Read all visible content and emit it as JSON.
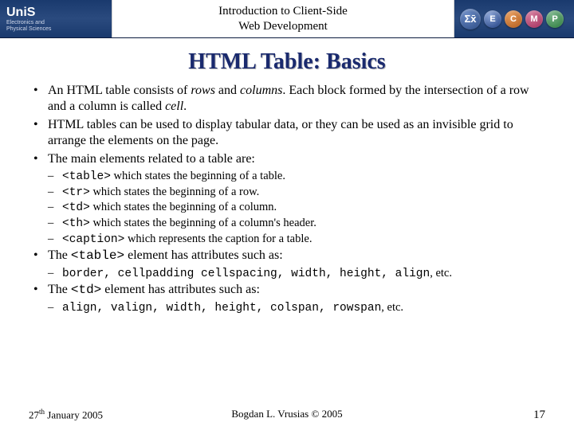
{
  "header": {
    "logo_text": "UniS",
    "logo_sub1": "Electronics and",
    "logo_sub2": "Physical Sciences",
    "title_line1": "Introduction to Client-Side",
    "title_line2": "Web Development",
    "badge_sigma": "Σx̄",
    "badge_e": "E",
    "badge_c": "C",
    "badge_m": "M",
    "badge_p": "P"
  },
  "slide_title": "HTML Table: Basics",
  "bullets": {
    "b1a": "An HTML table consists of ",
    "b1_rows": "rows",
    "b1b": " and ",
    "b1_cols": "columns",
    "b1c": ". Each block formed by the intersection of a row and a column is called ",
    "b1_cell": "cell",
    "b1d": ".",
    "b2": "HTML tables can be used to display tabular data, or they can be used as an invisible grid to arrange the elements on the page.",
    "b3": "The main elements related to a table are:",
    "s1_tag": "<table>",
    "s1_text": " which states the beginning of a table.",
    "s2_tag": "<tr>",
    "s2_text": " which states the beginning of a row.",
    "s3_tag": "<td>",
    "s3_text": " which states the beginning of a column.",
    "s4_tag": "<th>",
    "s4_text": " which states the beginning of a column's header.",
    "s5_tag": "<caption>",
    "s5_text": " which represents the caption for a table.",
    "b4a": "The ",
    "b4_tag": "<table>",
    "b4b": " element has attributes such as:",
    "s6_attrs": "border, cellpadding cellspacing, width, height, align",
    "s6_etc": ", etc.",
    "b5a": "The ",
    "b5_tag": "<td>",
    "b5b": " element has attributes such as:",
    "s7_attrs": "align, valign, width, height, colspan, rowspan",
    "s7_etc": ", etc."
  },
  "footer": {
    "date_day": "27",
    "date_sup": "th",
    "date_rest": " January 2005",
    "center": "Bogdan L. Vrusias © 2005",
    "page": "17"
  }
}
